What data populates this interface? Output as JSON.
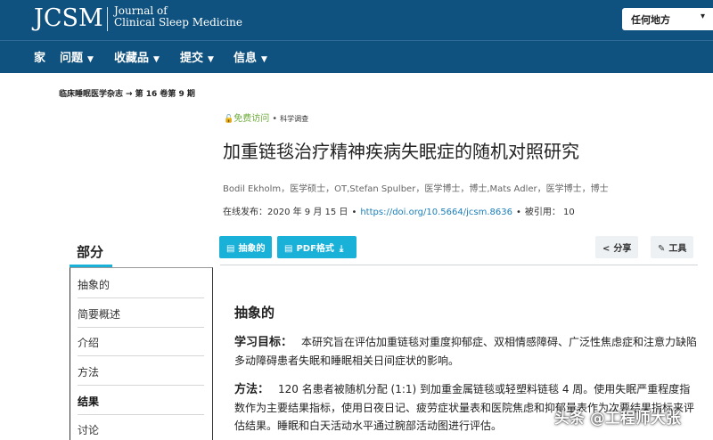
{
  "header": {
    "logo": "JCSM",
    "journal_line1": "Journal of",
    "journal_line2": "Clinical Sleep Medicine",
    "search_scope": "任何地方"
  },
  "nav": {
    "items": [
      {
        "label": "家"
      },
      {
        "label": "问题"
      },
      {
        "label": "收藏品"
      },
      {
        "label": "提交"
      },
      {
        "label": "信息"
      }
    ]
  },
  "breadcrumb": {
    "journal": "临床睡眠医学杂志",
    "issue": "第 16 卷第 9 期"
  },
  "article": {
    "access": "免费访问",
    "type": "科学调查",
    "title": "加重链毯治疗精神疾病失眠症的随机对照研究",
    "authors": "Bodil Ekholm，医学硕士，OT,Stefan Spulber，医学博士，博士,Mats Adler，医学博士，博士",
    "published": "在线发布：2020 年 9 月 15 日",
    "doi": "https://doi.org/10.5664/jcsm.8636",
    "cited": "被引用：  10"
  },
  "actions": {
    "abstract": "抽象的",
    "pdf": "PDF格式",
    "share": "分享",
    "tools": "工具"
  },
  "toc": {
    "heading": "部分",
    "items": [
      "抽象的",
      "简要概述",
      "介绍",
      "方法",
      "结果",
      "讨论"
    ],
    "active_index": 4
  },
  "abstract": {
    "heading": "抽象的",
    "objectives_lead": "学习目标：",
    "objectives_text": "本研究旨在评估加重链毯对重度抑郁症、双相情感障碍、广泛性焦虑症和注意力缺陷多动障碍患者失眠和睡眠相关日间症状的影响。",
    "methods_lead": "方法：",
    "methods_text": "120 名患者被随机分配 (1:1) 到加重金属链毯或轻塑料链毯 4 周。使用失眠严重程度指数作为主要结果指标，使用日夜日记、疲劳症状量表和医院焦虑和抑郁量表作为次要结果指标来评估结果。睡眠和白天活动水平通过腕部活动图进行评估。"
  },
  "watermark": "头条 @工程师大张",
  "colors": {
    "header_bg": "#10527f",
    "accent": "#1ab1d9",
    "free_access": "#6bab38",
    "link": "#1a7fbb"
  }
}
